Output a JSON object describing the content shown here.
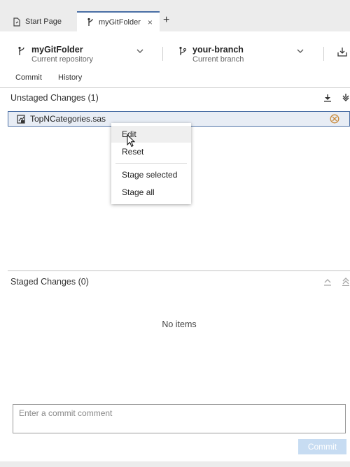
{
  "tabs": [
    {
      "label": "Start Page",
      "icon": "start-page-icon"
    },
    {
      "label": "myGitFolder",
      "icon": "git-folder-icon",
      "active": true
    }
  ],
  "tab_close": "×",
  "tab_add": "+",
  "repository": {
    "name": "myGitFolder",
    "subtitle": "Current repository"
  },
  "branch": {
    "name": "your-branch",
    "subtitle": "Current branch"
  },
  "subtabs": [
    "Commit",
    "History"
  ],
  "unstaged": {
    "title": "Unstaged Changes (1)",
    "files": [
      {
        "name": "TopNCategories.sas",
        "icon": "sas-file-icon",
        "status": "conflict"
      }
    ]
  },
  "context_menu": {
    "items": [
      "Edit",
      "Reset",
      "Stage selected",
      "Stage all"
    ],
    "hovered": "Edit"
  },
  "staged": {
    "title": "Staged Changes (0)",
    "empty_text": "No items"
  },
  "commit": {
    "placeholder": "Enter a commit comment",
    "button_label": "Commit",
    "enabled": false
  },
  "colors": {
    "accent": "#4a6fa5",
    "selected_row_bg": "#e8edf5",
    "disabled_button_bg": "#c7dcf2",
    "conflict": "#c98a3a",
    "background": "#ececec"
  }
}
